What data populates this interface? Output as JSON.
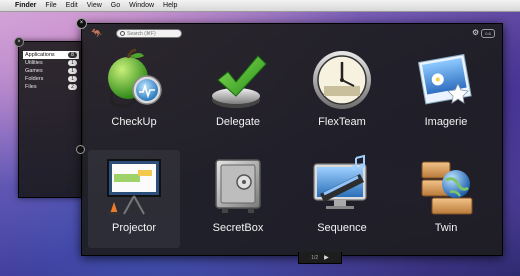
{
  "menubar": {
    "apple": "",
    "items": [
      "Finder",
      "File",
      "Edit",
      "View",
      "Go",
      "Window",
      "Help"
    ]
  },
  "sidebar": {
    "items": [
      {
        "label": "Applications",
        "count": "8"
      },
      {
        "label": "Utilities",
        "count": "1"
      },
      {
        "label": "Games",
        "count": "1"
      },
      {
        "label": "Folders",
        "count": "1"
      },
      {
        "label": "Files",
        "count": "2"
      }
    ]
  },
  "main": {
    "search_placeholder": "Search (⌘F)",
    "zoom_label": "0.6",
    "apps": [
      {
        "label": "CheckUp",
        "icon": "apple-stethoscope-icon"
      },
      {
        "label": "Delegate",
        "icon": "checkmark-icon"
      },
      {
        "label": "FlexTeam",
        "icon": "clock-icon"
      },
      {
        "label": "Imagerie",
        "icon": "photos-icon"
      },
      {
        "label": "Projector",
        "icon": "projector-screen-icon"
      },
      {
        "label": "SecretBox",
        "icon": "safe-icon"
      },
      {
        "label": "Sequence",
        "icon": "film-monitor-icon"
      },
      {
        "label": "Twin",
        "icon": "globe-drawers-icon"
      }
    ],
    "pager": "1/2"
  },
  "colors": {
    "window_bg": "#1c1c1e",
    "accent_green": "#3fae2a",
    "desktop": "#402f8d"
  }
}
